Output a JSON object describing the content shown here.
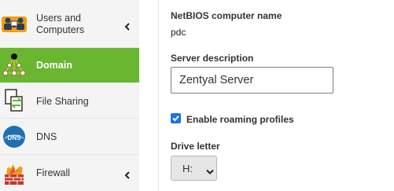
{
  "sidebar": {
    "items": [
      {
        "label_line1": "Users and",
        "label_line2": "Computers",
        "icon": "users-computers-icon",
        "has_submenu": true
      },
      {
        "label": "Domain",
        "icon": "domain-icon",
        "active": true
      },
      {
        "label": "File Sharing",
        "icon": "file-sharing-icon"
      },
      {
        "label": "DNS",
        "icon": "dns-icon",
        "icon_text": "DNS"
      },
      {
        "label": "Firewall",
        "icon": "firewall-icon",
        "has_submenu": true
      }
    ]
  },
  "form": {
    "netbios": {
      "label": "NetBIOS computer name",
      "value": "pdc"
    },
    "description": {
      "label": "Server description",
      "value": "Zentyal Server"
    },
    "roaming": {
      "label": "Enable roaming profiles",
      "checked": true
    },
    "drive": {
      "label": "Drive letter",
      "value": "H:"
    }
  },
  "colors": {
    "active_bg": "#6ab630",
    "checkbox": "#1a73e8",
    "sidebar_bg": "#f4f4f4"
  }
}
